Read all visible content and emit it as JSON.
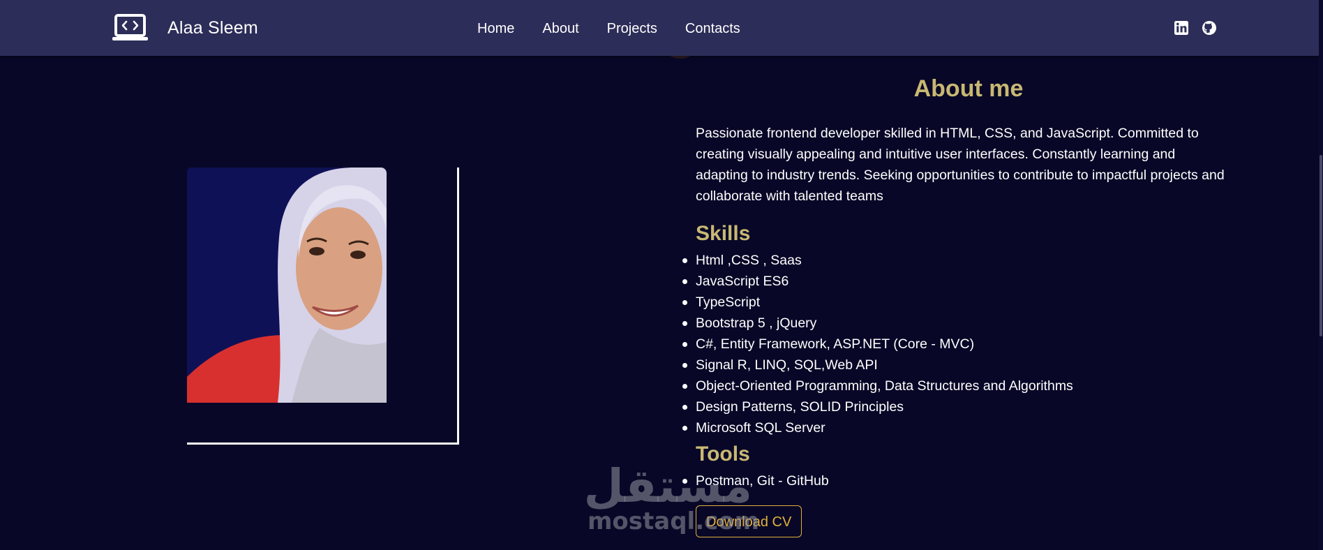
{
  "navbar": {
    "brand_name": "Alaa Sleem",
    "links": [
      {
        "label": "Home"
      },
      {
        "label": "About"
      },
      {
        "label": "Projects"
      },
      {
        "label": "Contacts"
      }
    ],
    "social_icons": [
      "linkedin-icon",
      "github-icon"
    ]
  },
  "about": {
    "title": "About me",
    "description": "Passionate frontend developer skilled in HTML, CSS, and JavaScript. Committed to creating visually appealing and intuitive user interfaces. Constantly learning and adapting to industry trends. Seeking opportunities to contribute to impactful projects and collaborate with talented teams",
    "skills_title": "Skills",
    "skills": [
      "Html ,CSS , Saas",
      "JavaScript ES6",
      "TypeScript",
      "Bootstrap 5 , jQuery",
      "C#, Entity Framework, ASP.NET (Core - MVC)",
      "Signal R, LINQ, SQL,Web API",
      "Object-Oriented Programming, Data Structures and Algorithms",
      "Design Patterns, SOLID Principles",
      "Microsoft SQL Server"
    ],
    "tools_title": "Tools",
    "tools": [
      "Postman, Git - GitHub"
    ],
    "cv_button_label": "Download CV"
  },
  "watermark": {
    "arabic": "مستقل",
    "latin": "mostaql.com"
  },
  "colors": {
    "background": "#080727",
    "navbar": "#2c2d58",
    "heading_gold": "#c8b873",
    "button_accent": "#e2b13c"
  }
}
